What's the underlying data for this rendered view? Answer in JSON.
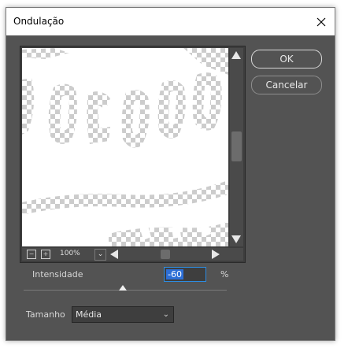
{
  "window": {
    "title": "Ondulação",
    "close_glyph": "✕"
  },
  "buttons": {
    "ok": "OK",
    "cancel": "Cancelar"
  },
  "preview": {
    "zoom_out_glyph": "−",
    "zoom_in_glyph": "+",
    "zoom_level": "100%",
    "zoom_dropdown_glyph": "⌄"
  },
  "controls": {
    "intensity_label": "Intensidade",
    "intensity_value": "-60",
    "intensity_unit": "%",
    "intensity_slider_level_percent": 50,
    "size_label": "Tamanho",
    "size_value": "Média",
    "size_chevron": "⌄"
  },
  "colors": {
    "dialog_bg": "#535353",
    "accent": "#2d8ce0",
    "text": "#e8e8e8"
  }
}
